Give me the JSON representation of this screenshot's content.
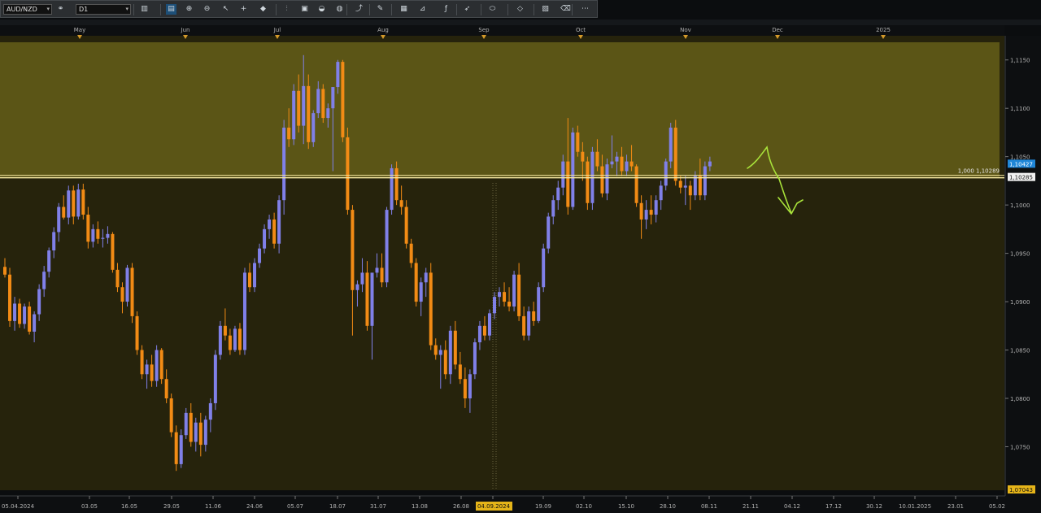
{
  "toolbar": {
    "symbol": "AUD/NZD",
    "timeframe": "D1",
    "icons": [
      "bar-chart-icon",
      "line-chart-icon",
      "zoom-in-icon",
      "zoom-out-icon",
      "cursor-icon",
      "crosshair-icon",
      "marker-icon",
      "period-separator-icon",
      "screenshot-icon",
      "indicator-icon",
      "globe-icon",
      "trend-icon",
      "pencil-icon",
      "template-icon",
      "gann-icon",
      "fibonacci-icon",
      "arrow-icon",
      "ellipse-icon",
      "shapes-icon",
      "color-icon",
      "eraser-icon",
      "more-icon"
    ]
  },
  "colors": {
    "background": "#26230c",
    "zone": "#5b5516",
    "bull": "#8080e8",
    "bear": "#f28b15",
    "level": "#f4e7a0",
    "drawing": "#a8e23a",
    "axis_text": "#b0b0b0",
    "price_tag": "#1f86d8"
  },
  "top_axis": [
    "May",
    "Jun",
    "Jul",
    "Aug",
    "Sep",
    "Oct",
    "Nov",
    "Dec",
    "2025"
  ],
  "bottom_axis": [
    "05.04.2024",
    "03.05",
    "16.05",
    "29.05",
    "11.06",
    "24.06",
    "05.07",
    "18.07",
    "31.07",
    "13.08",
    "26.08",
    "04.09.2024",
    "19.09",
    "02.10",
    "15.10",
    "28.10",
    "08.11",
    "21.11",
    "04.12",
    "17.12",
    "30.12",
    "10.01.2025",
    "23.01",
    "05.02"
  ],
  "price_axis": [
    "1,1150",
    "1,1100",
    "1,1050",
    "1,1000",
    "1,0950",
    "1,0900",
    "1,0850",
    "1,0800",
    "1,0750"
  ],
  "current_price": "1,10427",
  "level_price": "1,10285",
  "level_label": "1,000 1,10289",
  "bottom_price": "1,07043",
  "chart_data": {
    "type": "candlestick",
    "symbol": "AUD/NZD",
    "timeframe": "D1",
    "ylim": [
      1.0705,
      1.1175
    ],
    "candles": [
      [
        1.0936,
        1.0945,
        1.0925,
        1.0928
      ],
      [
        1.0928,
        1.0935,
        1.0874,
        1.088
      ],
      [
        1.088,
        1.0905,
        1.087,
        1.0898
      ],
      [
        1.0898,
        1.0903,
        1.0873,
        1.0877
      ],
      [
        1.0877,
        1.0898,
        1.0872,
        1.0895
      ],
      [
        1.0895,
        1.09,
        1.0866,
        1.0869
      ],
      [
        1.0869,
        1.089,
        1.0858,
        1.0887
      ],
      [
        1.0887,
        1.0918,
        1.088,
        1.0913
      ],
      [
        1.0913,
        1.0937,
        1.0905,
        1.0931
      ],
      [
        1.0931,
        1.0956,
        1.0925,
        1.0953
      ],
      [
        1.0953,
        1.0977,
        1.0945,
        1.0972
      ],
      [
        1.0972,
        1.1002,
        1.0962,
        1.0998
      ],
      [
        1.0998,
        1.101,
        1.0985,
        1.0987
      ],
      [
        1.0987,
        1.102,
        1.098,
        1.1015
      ],
      [
        1.1015,
        1.102,
        1.098,
        1.0988
      ],
      [
        1.0988,
        1.1022,
        1.0985,
        1.1016
      ],
      [
        1.1016,
        1.1022,
        1.0985,
        1.099
      ],
      [
        1.099,
        1.0998,
        1.0955,
        1.0962
      ],
      [
        1.0962,
        1.098,
        1.0956,
        1.0975
      ],
      [
        1.0975,
        1.0983,
        1.096,
        1.0965
      ],
      [
        1.0965,
        1.0975,
        1.0956,
        1.0966
      ],
      [
        1.0966,
        1.0978,
        1.096,
        1.097
      ],
      [
        1.097,
        1.0972,
        1.093,
        1.0933
      ],
      [
        1.0933,
        1.094,
        1.091,
        1.0915
      ],
      [
        1.0915,
        1.092,
        1.0888,
        1.09
      ],
      [
        1.09,
        1.0938,
        1.0895,
        1.0935
      ],
      [
        1.0935,
        1.094,
        1.0878,
        1.0885
      ],
      [
        1.0885,
        1.089,
        1.0845,
        1.085
      ],
      [
        1.085,
        1.0855,
        1.082,
        1.0825
      ],
      [
        1.0825,
        1.084,
        1.081,
        1.0835
      ],
      [
        1.0835,
        1.0845,
        1.0812,
        1.0818
      ],
      [
        1.0818,
        1.0855,
        1.0812,
        1.085
      ],
      [
        1.085,
        1.0852,
        1.0815,
        1.082
      ],
      [
        1.082,
        1.083,
        1.0795,
        1.08
      ],
      [
        1.08,
        1.0805,
        1.076,
        1.0765
      ],
      [
        1.0765,
        1.0772,
        1.0725,
        1.0732
      ],
      [
        1.0732,
        1.0768,
        1.0728,
        1.0762
      ],
      [
        1.0762,
        1.079,
        1.0758,
        1.0785
      ],
      [
        1.0785,
        1.0795,
        1.075,
        1.0755
      ],
      [
        1.0755,
        1.078,
        1.0745,
        1.0775
      ],
      [
        1.0775,
        1.0785,
        1.074,
        1.0752
      ],
      [
        1.0752,
        1.0782,
        1.0745,
        1.0778
      ],
      [
        1.0778,
        1.08,
        1.0765,
        1.0795
      ],
      [
        1.0795,
        1.085,
        1.0788,
        1.0845
      ],
      [
        1.0845,
        1.088,
        1.084,
        1.0875
      ],
      [
        1.0875,
        1.0893,
        1.086,
        1.0865
      ],
      [
        1.0865,
        1.0872,
        1.0845,
        1.085
      ],
      [
        1.085,
        1.0875,
        1.0848,
        1.0872
      ],
      [
        1.0872,
        1.0878,
        1.0845,
        1.085
      ],
      [
        1.085,
        1.0935,
        1.0845,
        1.093
      ],
      [
        1.093,
        1.094,
        1.091,
        1.0915
      ],
      [
        1.0915,
        1.0945,
        1.091,
        1.094
      ],
      [
        1.094,
        1.096,
        1.0935,
        1.0955
      ],
      [
        1.0955,
        1.098,
        1.095,
        1.0975
      ],
      [
        1.0975,
        1.099,
        1.0965,
        1.0985
      ],
      [
        1.0985,
        1.0992,
        1.0955,
        1.096
      ],
      [
        1.096,
        1.101,
        1.095,
        1.1005
      ],
      [
        1.1005,
        1.1088,
        1.099,
        1.108
      ],
      [
        1.108,
        1.11,
        1.106,
        1.1068
      ],
      [
        1.1068,
        1.1125,
        1.1062,
        1.1118
      ],
      [
        1.1118,
        1.1135,
        1.1075,
        1.1082
      ],
      [
        1.1082,
        1.1155,
        1.1063,
        1.1123
      ],
      [
        1.1123,
        1.1135,
        1.1058,
        1.1065
      ],
      [
        1.1065,
        1.1098,
        1.106,
        1.1095
      ],
      [
        1.1095,
        1.1128,
        1.109,
        1.112
      ],
      [
        1.112,
        1.1125,
        1.1085,
        1.109
      ],
      [
        1.109,
        1.1105,
        1.108,
        1.11
      ],
      [
        1.11,
        1.112,
        1.1035,
        1.1122
      ],
      [
        1.1122,
        1.115,
        1.1115,
        1.1148
      ],
      [
        1.1148,
        1.115,
        1.1065,
        1.107
      ],
      [
        1.107,
        1.108,
        1.099,
        1.0995
      ],
      [
        1.0995,
        1.1,
        1.0865,
        1.0912
      ],
      [
        1.0912,
        1.0922,
        1.0895,
        1.0918
      ],
      [
        1.0918,
        1.0945,
        1.091,
        1.093
      ],
      [
        1.093,
        1.0942,
        1.087,
        1.0875
      ],
      [
        1.0875,
        1.0885,
        1.084,
        1.093
      ],
      [
        1.093,
        1.095,
        1.0925,
        1.0935
      ],
      [
        1.0935,
        1.095,
        1.0915,
        1.092
      ],
      [
        1.092,
        1.0998,
        1.0915,
        1.0995
      ],
      [
        1.0995,
        1.1042,
        1.099,
        1.1038
      ],
      [
        1.1038,
        1.1045,
        1.1,
        1.1005
      ],
      [
        1.1005,
        1.102,
        1.099,
        1.0998
      ],
      [
        1.0998,
        1.1005,
        1.0955,
        1.096
      ],
      [
        1.096,
        1.0965,
        1.0935,
        1.094
      ],
      [
        1.094,
        1.0945,
        1.0895,
        1.09
      ],
      [
        1.09,
        1.0925,
        1.0885,
        1.092
      ],
      [
        1.092,
        1.0935,
        1.0905,
        1.093
      ],
      [
        1.093,
        1.094,
        1.085,
        1.0855
      ],
      [
        1.0855,
        1.0862,
        1.084,
        1.0845
      ],
      [
        1.0845,
        1.0855,
        1.081,
        1.085
      ],
      [
        1.085,
        1.086,
        1.082,
        1.0825
      ],
      [
        1.0825,
        1.0875,
        1.0815,
        1.087
      ],
      [
        1.087,
        1.088,
        1.083,
        1.0835
      ],
      [
        1.0835,
        1.0848,
        1.0815,
        1.082
      ],
      [
        1.082,
        1.0832,
        1.079,
        1.08
      ],
      [
        1.08,
        1.083,
        1.0785,
        1.0825
      ],
      [
        1.0825,
        1.0862,
        1.082,
        1.0858
      ],
      [
        1.0858,
        1.088,
        1.085,
        1.0875
      ],
      [
        1.0875,
        1.0885,
        1.086,
        1.0865
      ],
      [
        1.0865,
        1.0892,
        1.086,
        1.0888
      ],
      [
        1.0888,
        1.091,
        1.0882,
        1.0905
      ],
      [
        1.0905,
        1.0915,
        1.0895,
        1.091
      ],
      [
        1.091,
        1.092,
        1.0895,
        1.09
      ],
      [
        1.09,
        1.0915,
        1.089,
        1.0895
      ],
      [
        1.0895,
        1.0932,
        1.089,
        1.0928
      ],
      [
        1.0928,
        1.094,
        1.088,
        1.0885
      ],
      [
        1.0885,
        1.0895,
        1.086,
        1.0865
      ],
      [
        1.0865,
        1.0895,
        1.086,
        1.089
      ],
      [
        1.089,
        1.09,
        1.0875,
        1.088
      ],
      [
        1.088,
        1.092,
        1.0878,
        1.0915
      ],
      [
        1.0915,
        1.096,
        1.091,
        1.0955
      ],
      [
        1.0955,
        1.0992,
        1.095,
        1.0988
      ],
      [
        1.0988,
        1.101,
        1.098,
        1.1005
      ],
      [
        1.1005,
        1.1025,
        1.0995,
        1.1018
      ],
      [
        1.1018,
        1.1052,
        1.101,
        1.1045
      ],
      [
        1.1045,
        1.109,
        1.099,
        1.0998
      ],
      [
        1.0998,
        1.108,
        1.0995,
        1.1075
      ],
      [
        1.1075,
        1.1082,
        1.105,
        1.1055
      ],
      [
        1.1055,
        1.1065,
        1.1025,
        1.1045
      ],
      [
        1.1045,
        1.105,
        1.0995,
        1.1002
      ],
      [
        1.1002,
        1.106,
        1.0995,
        1.1055
      ],
      [
        1.1055,
        1.1068,
        1.1035,
        1.104
      ],
      [
        1.104,
        1.1052,
        1.1008,
        1.1012
      ],
      [
        1.1012,
        1.1048,
        1.1005,
        1.1042
      ],
      [
        1.1042,
        1.1072,
        1.1038,
        1.1045
      ],
      [
        1.1045,
        1.1055,
        1.103,
        1.105
      ],
      [
        1.105,
        1.106,
        1.103,
        1.1035
      ],
      [
        1.1035,
        1.1052,
        1.103,
        1.1045
      ],
      [
        1.1045,
        1.1062,
        1.1035,
        1.104
      ],
      [
        1.104,
        1.1042,
        1.0998,
        1.1002
      ],
      [
        1.1002,
        1.101,
        1.0965,
        1.0985
      ],
      [
        1.0985,
        1.1005,
        1.0975,
        1.0995
      ],
      [
        1.0995,
        1.101,
        1.098,
        1.099
      ],
      [
        1.099,
        1.101,
        1.0982,
        1.1005
      ],
      [
        1.1005,
        1.1025,
        1.0995,
        1.102
      ],
      [
        1.102,
        1.1048,
        1.1015,
        1.1045
      ],
      [
        1.1045,
        1.1085,
        1.1038,
        1.108
      ],
      [
        1.108,
        1.1088,
        1.102,
        1.1025
      ],
      [
        1.1025,
        1.103,
        1.1012,
        1.1018
      ],
      [
        1.1018,
        1.103,
        1.1,
        1.102
      ],
      [
        1.102,
        1.1025,
        1.0995,
        1.101
      ],
      [
        1.101,
        1.1035,
        1.1005,
        1.103
      ],
      [
        1.103,
        1.1048,
        1.1005,
        1.101
      ],
      [
        1.101,
        1.1045,
        1.1005,
        1.104
      ],
      [
        1.104,
        1.105,
        1.1035,
        1.1045
      ]
    ]
  }
}
